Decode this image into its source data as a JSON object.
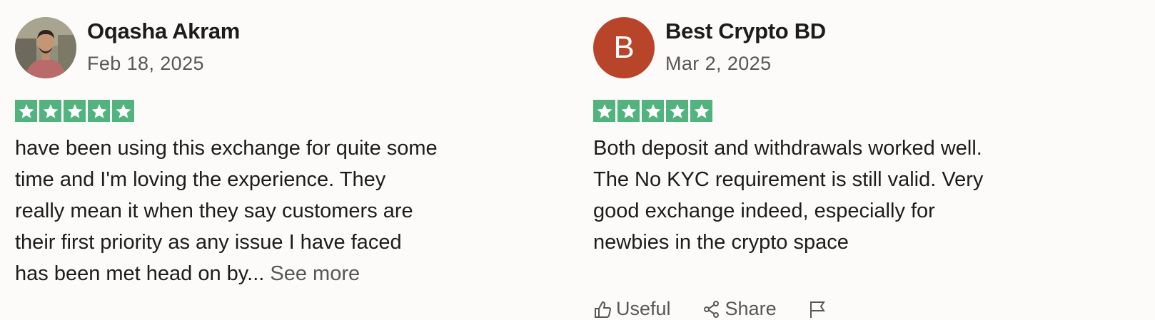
{
  "colors": {
    "star_green": "#52b37f",
    "avatar_b": "#b8442a",
    "muted": "#575757"
  },
  "reviews": [
    {
      "name": "Oqasha Akram",
      "date": "Feb 18, 2025",
      "rating": 5,
      "lines": [
        "have been using this exchange for quite some",
        "time and I'm loving the experience. They",
        "really mean it when they say customers are",
        "their first priority as any issue I have faced",
        "has been met head on by..."
      ],
      "see_more": "See more"
    },
    {
      "name": "Best Crypto BD",
      "avatar_letter": "B",
      "date": "Mar 2, 2025",
      "rating": 5,
      "lines": [
        "Both deposit and withdrawals worked well.",
        "The No KYC requirement is still valid. Very",
        "good exchange indeed, especially for",
        "newbies in the crypto space"
      ],
      "actions": {
        "useful": "Useful",
        "share": "Share"
      }
    }
  ]
}
